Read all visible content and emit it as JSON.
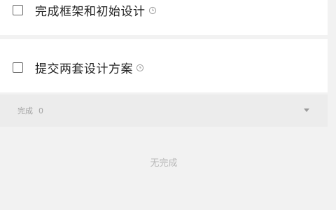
{
  "tasks": [
    {
      "title": "完成框架和初始设计",
      "checked": false,
      "icon": "clock-icon"
    },
    {
      "title": "提交两套设计方案",
      "checked": false,
      "icon": "clock-icon"
    }
  ],
  "completed_section": {
    "label": "完成",
    "count": "0",
    "toggle_icon": "caret-down-icon"
  },
  "empty_state": {
    "text": "无完成"
  },
  "colors": {
    "background": "#f2f2f2",
    "card": "#ffffff",
    "section_header": "#ececec",
    "task_text": "#1f1f1f",
    "muted_text": "#a3a3a3"
  }
}
